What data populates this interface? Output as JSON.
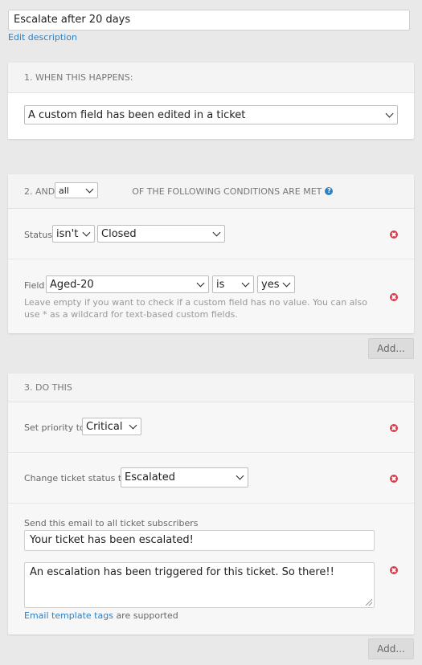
{
  "rule": {
    "name": "Escalate after 20 days",
    "edit_description": "Edit description"
  },
  "section1": {
    "heading": "1. WHEN THIS HAPPENS:",
    "trigger": "A custom field has been edited in a ticket"
  },
  "section2": {
    "heading_prefix": "2. AND",
    "match_mode": "all",
    "heading_suffix": "OF THE FOLLOWING CONDITIONS ARE MET",
    "conditions": [
      {
        "label": "Status",
        "operator": "isn't",
        "value": "Closed"
      },
      {
        "label": "Field",
        "field": "Aged-20",
        "operator": "is",
        "value": "yes",
        "help": "Leave empty if you want to check if a custom field has no value. You can also use * as a wildcard for text-based custom fields."
      }
    ],
    "add_label": "Add..."
  },
  "section3": {
    "heading": "3. DO THIS",
    "priority_label": "Set priority to",
    "priority_value": "Critical",
    "status_label": "Change ticket status to",
    "status_value": "Escalated",
    "email_label": "Send this email to all ticket subscribers",
    "email_subject": "Your ticket has been escalated!",
    "email_body": "An escalation has been triggered for this ticket. So there!!",
    "template_link": "Email template tags",
    "template_suffix": "are supported",
    "add_label": "Add..."
  },
  "colors": {
    "accent": "#2f7fc1",
    "remove": "#d9394b",
    "background": "#e9e9e9"
  },
  "icons": [
    "help-icon",
    "remove-icon",
    "chevron-down-icon",
    "resize-grip-icon"
  ]
}
